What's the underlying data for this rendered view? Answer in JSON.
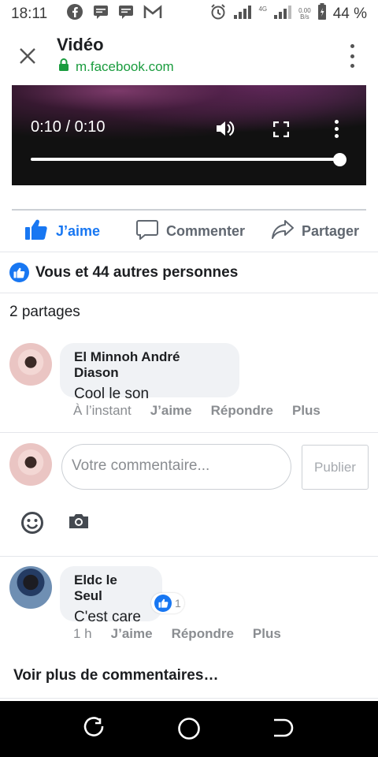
{
  "status_bar": {
    "time": "18:11",
    "network": "4G",
    "speed": "0.00",
    "speed_unit": "B/s",
    "battery": "44 %"
  },
  "header": {
    "title": "Vidéo",
    "url": "m.facebook.com"
  },
  "video": {
    "timecode": "0:10 / 0:10",
    "progress_fraction": 1.0
  },
  "actions": {
    "like": "J’aime",
    "comment": "Commenter",
    "share": "Partager"
  },
  "reactions_summary": "Vous et 44 autres personnes",
  "shares_count": "2 partages",
  "comments": [
    {
      "author": "El Minnoh André Diason",
      "text": "Cool le son",
      "time": "À l’instant",
      "like": "J’aime",
      "reply": "Répondre",
      "more": "Plus"
    },
    {
      "author": "Eldc le Seul",
      "text": "C'est care",
      "time": "1 h",
      "like": "J’aime",
      "reply": "Répondre",
      "more": "Plus",
      "reaction_count": "1"
    }
  ],
  "composer": {
    "placeholder": "Votre commentaire...",
    "publish": "Publier"
  },
  "see_more": "Voir plus de commentaires…",
  "colors": {
    "facebook_blue": "#1877f2",
    "secure_green": "#1a9c3e",
    "secondary_text": "#8a8d91"
  }
}
